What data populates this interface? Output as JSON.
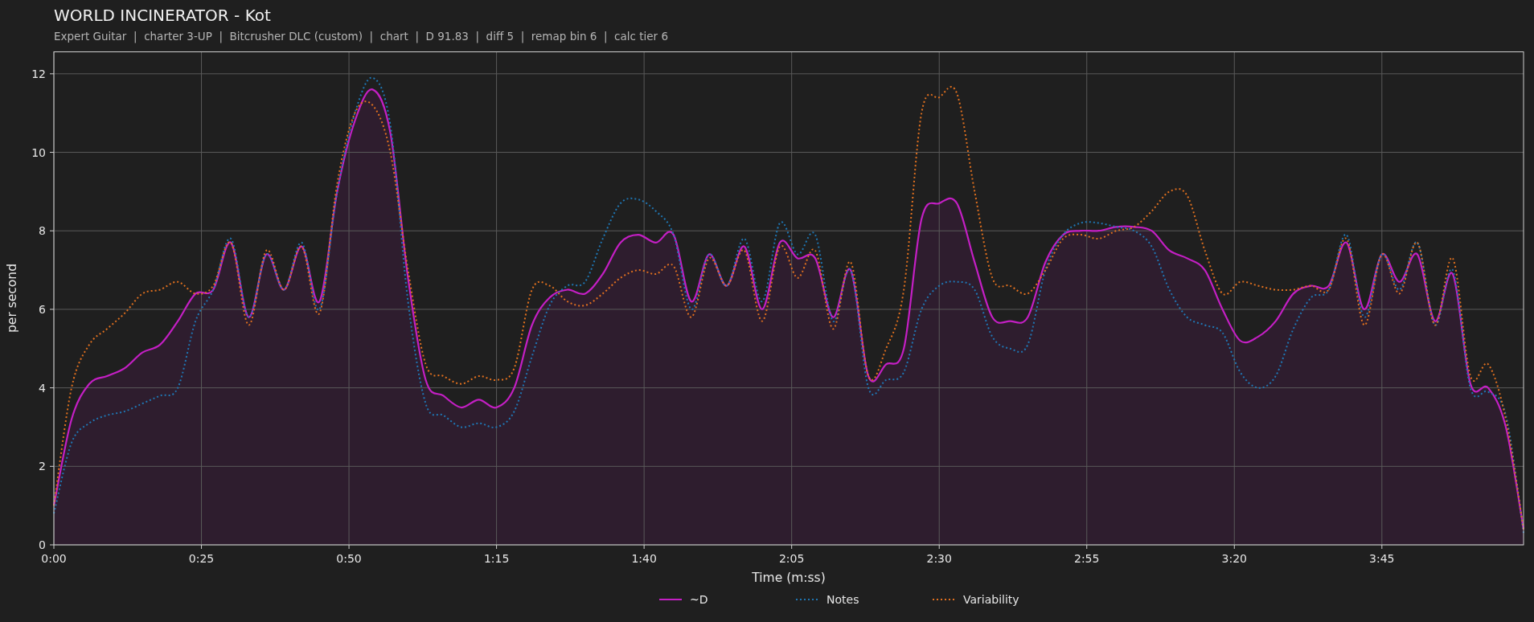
{
  "title": "WORLD INCINERATOR - Kot",
  "subtitle": "Expert Guitar  |  charter 3-UP  |  Bitcrusher DLC (custom)  |  chart  |  D 91.83  |  diff 5  |  remap bin 6  |  calc tier 6",
  "chart_data": {
    "type": "line",
    "grid": true,
    "legend": true,
    "xlabel": "Time (m:ss)",
    "ylabel": "per second",
    "xlim": [
      0,
      249
    ],
    "ylim": [
      0,
      12.57
    ],
    "xticks": [
      {
        "value": 0,
        "label": "0:00"
      },
      {
        "value": 25,
        "label": "0:25"
      },
      {
        "value": 50,
        "label": "0:50"
      },
      {
        "value": 75,
        "label": "1:15"
      },
      {
        "value": 100,
        "label": "1:40"
      },
      {
        "value": 125,
        "label": "2:05"
      },
      {
        "value": 150,
        "label": "2:30"
      },
      {
        "value": 175,
        "label": "2:55"
      },
      {
        "value": 200,
        "label": "3:20"
      },
      {
        "value": 225,
        "label": "3:45"
      }
    ],
    "yticks": [
      0,
      2,
      4,
      6,
      8,
      10,
      12
    ],
    "x": [
      0,
      3,
      6,
      9,
      12,
      15,
      18,
      21,
      24,
      27,
      30,
      33,
      36,
      39,
      42,
      45,
      48,
      51,
      54,
      57,
      60,
      63,
      66,
      69,
      72,
      75,
      78,
      81,
      84,
      87,
      90,
      93,
      96,
      99,
      102,
      105,
      108,
      111,
      114,
      117,
      120,
      123,
      126,
      129,
      132,
      135,
      138,
      141,
      144,
      147,
      150,
      153,
      156,
      159,
      162,
      165,
      168,
      171,
      174,
      177,
      180,
      183,
      186,
      189,
      192,
      195,
      198,
      201,
      204,
      207,
      210,
      213,
      216,
      219,
      222,
      225,
      228,
      231,
      234,
      237,
      240,
      243,
      246,
      249
    ],
    "series": [
      {
        "name": "~D",
        "color": "#c41fc4",
        "line_style": "solid",
        "type": "area",
        "values": [
          1.0,
          3.2,
          4.1,
          4.3,
          4.5,
          4.9,
          5.1,
          5.7,
          6.4,
          6.5,
          7.7,
          5.8,
          7.4,
          6.5,
          7.6,
          6.2,
          9.0,
          10.8,
          11.6,
          10.5,
          6.8,
          4.2,
          3.8,
          3.5,
          3.7,
          3.5,
          4.0,
          5.6,
          6.3,
          6.5,
          6.4,
          6.9,
          7.7,
          7.9,
          7.7,
          7.9,
          6.2,
          7.4,
          6.6,
          7.6,
          6.0,
          7.7,
          7.3,
          7.3,
          5.8,
          7.0,
          4.3,
          4.6,
          5.0,
          8.3,
          8.7,
          8.7,
          7.2,
          5.8,
          5.7,
          5.8,
          7.2,
          7.9,
          8.0,
          8.0,
          8.1,
          8.1,
          8.0,
          7.5,
          7.3,
          7.0,
          6.0,
          5.2,
          5.3,
          5.7,
          6.4,
          6.6,
          6.6,
          7.7,
          6.0,
          7.4,
          6.7,
          7.4,
          5.7,
          6.9,
          4.1,
          4.0,
          3.0,
          0.4
        ]
      },
      {
        "name": "Notes",
        "color": "#1f77b4",
        "line_style": "dotted",
        "type": "line",
        "values": [
          0.8,
          2.6,
          3.1,
          3.3,
          3.4,
          3.6,
          3.8,
          4.0,
          5.7,
          6.5,
          7.8,
          5.8,
          7.4,
          6.5,
          7.7,
          6.0,
          9.0,
          11.0,
          11.9,
          10.7,
          6.2,
          3.6,
          3.3,
          3.0,
          3.1,
          3.0,
          3.4,
          4.8,
          6.1,
          6.6,
          6.7,
          7.8,
          8.7,
          8.8,
          8.5,
          7.9,
          6.0,
          7.4,
          6.6,
          7.8,
          6.2,
          8.2,
          7.4,
          7.9,
          5.7,
          7.0,
          4.0,
          4.2,
          4.4,
          6.0,
          6.6,
          6.7,
          6.5,
          5.3,
          5.0,
          5.1,
          7.0,
          7.9,
          8.2,
          8.2,
          8.1,
          8.0,
          7.6,
          6.5,
          5.8,
          5.6,
          5.4,
          4.4,
          4.0,
          4.3,
          5.5,
          6.3,
          6.5,
          7.9,
          5.8,
          7.4,
          6.5,
          7.7,
          5.6,
          7.0,
          4.0,
          3.9,
          3.3,
          0.3
        ]
      },
      {
        "name": "Variability",
        "color": "#e0701f",
        "line_style": "dotted",
        "type": "line",
        "values": [
          1.0,
          4.0,
          5.1,
          5.5,
          5.9,
          6.4,
          6.5,
          6.7,
          6.4,
          6.6,
          7.7,
          5.6,
          7.5,
          6.5,
          7.6,
          5.9,
          9.2,
          11.0,
          11.2,
          10.0,
          7.0,
          4.6,
          4.3,
          4.1,
          4.3,
          4.2,
          4.5,
          6.5,
          6.6,
          6.2,
          6.1,
          6.4,
          6.8,
          7.0,
          6.9,
          7.1,
          5.8,
          7.3,
          6.6,
          7.5,
          5.7,
          7.6,
          6.8,
          7.5,
          5.5,
          7.2,
          4.3,
          5.0,
          6.5,
          11.0,
          11.4,
          11.5,
          9.0,
          6.8,
          6.6,
          6.4,
          7.0,
          7.8,
          7.9,
          7.8,
          8.0,
          8.1,
          8.5,
          9.0,
          8.9,
          7.5,
          6.4,
          6.7,
          6.6,
          6.5,
          6.5,
          6.6,
          6.5,
          7.8,
          5.6,
          7.4,
          6.4,
          7.7,
          5.6,
          7.3,
          4.3,
          4.6,
          3.2,
          0.4
        ]
      }
    ]
  }
}
